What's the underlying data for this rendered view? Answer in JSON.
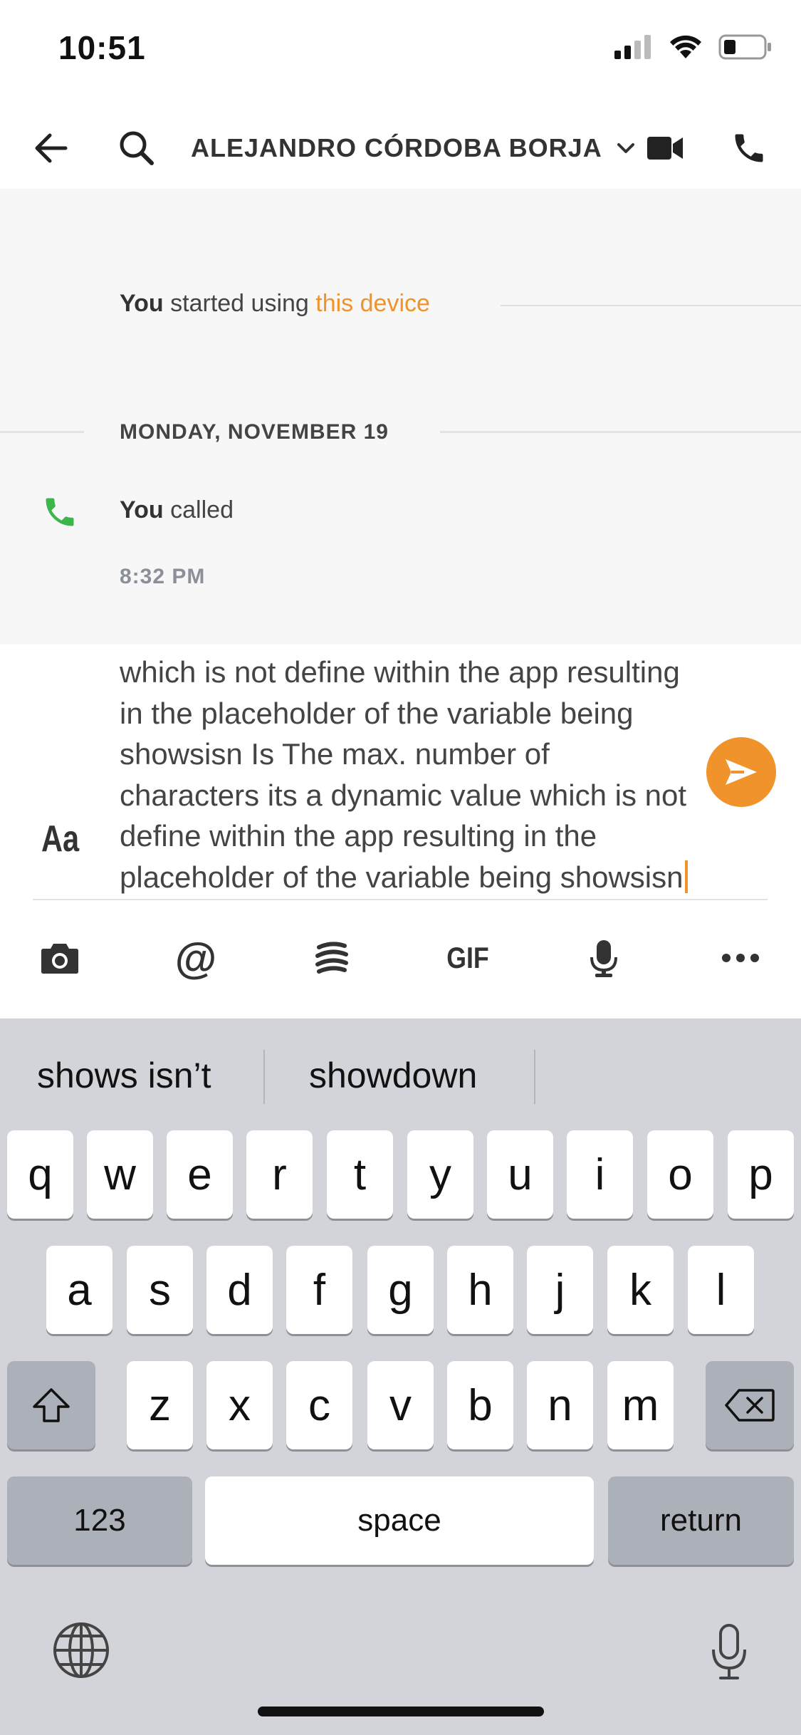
{
  "status_bar": {
    "time": "10:51"
  },
  "header": {
    "contact_name": "ALEJANDRO CÓRDOBA BORJA"
  },
  "chat": {
    "system_message": {
      "actor": "You",
      "text": " started using ",
      "link": "this device"
    },
    "date_separator": "MONDAY, NOVEMBER 19",
    "call_event": {
      "actor": "You",
      "text": " called",
      "time": "8:32 PM"
    }
  },
  "composer": {
    "text": "which is not define within the app resulting in the placeholder of the variable being showsisn Is The max. number of characters its a dynamic value which is not define within the app resulting in the placeholder of the variable being showsisn",
    "format_label": "Aa"
  },
  "toolbar": {
    "gif_label": "GIF"
  },
  "keyboard": {
    "suggestions": [
      "shows isn’t",
      "showdown"
    ],
    "row1": [
      "q",
      "w",
      "e",
      "r",
      "t",
      "y",
      "u",
      "i",
      "o",
      "p"
    ],
    "row2": [
      "a",
      "s",
      "d",
      "f",
      "g",
      "h",
      "j",
      "k",
      "l"
    ],
    "row3": [
      "z",
      "x",
      "c",
      "v",
      "b",
      "n",
      "m"
    ],
    "numbers_label": "123",
    "space_label": "space",
    "return_label": "return"
  },
  "colors": {
    "accent": "#f0932b",
    "call_green": "#3cb54a"
  }
}
